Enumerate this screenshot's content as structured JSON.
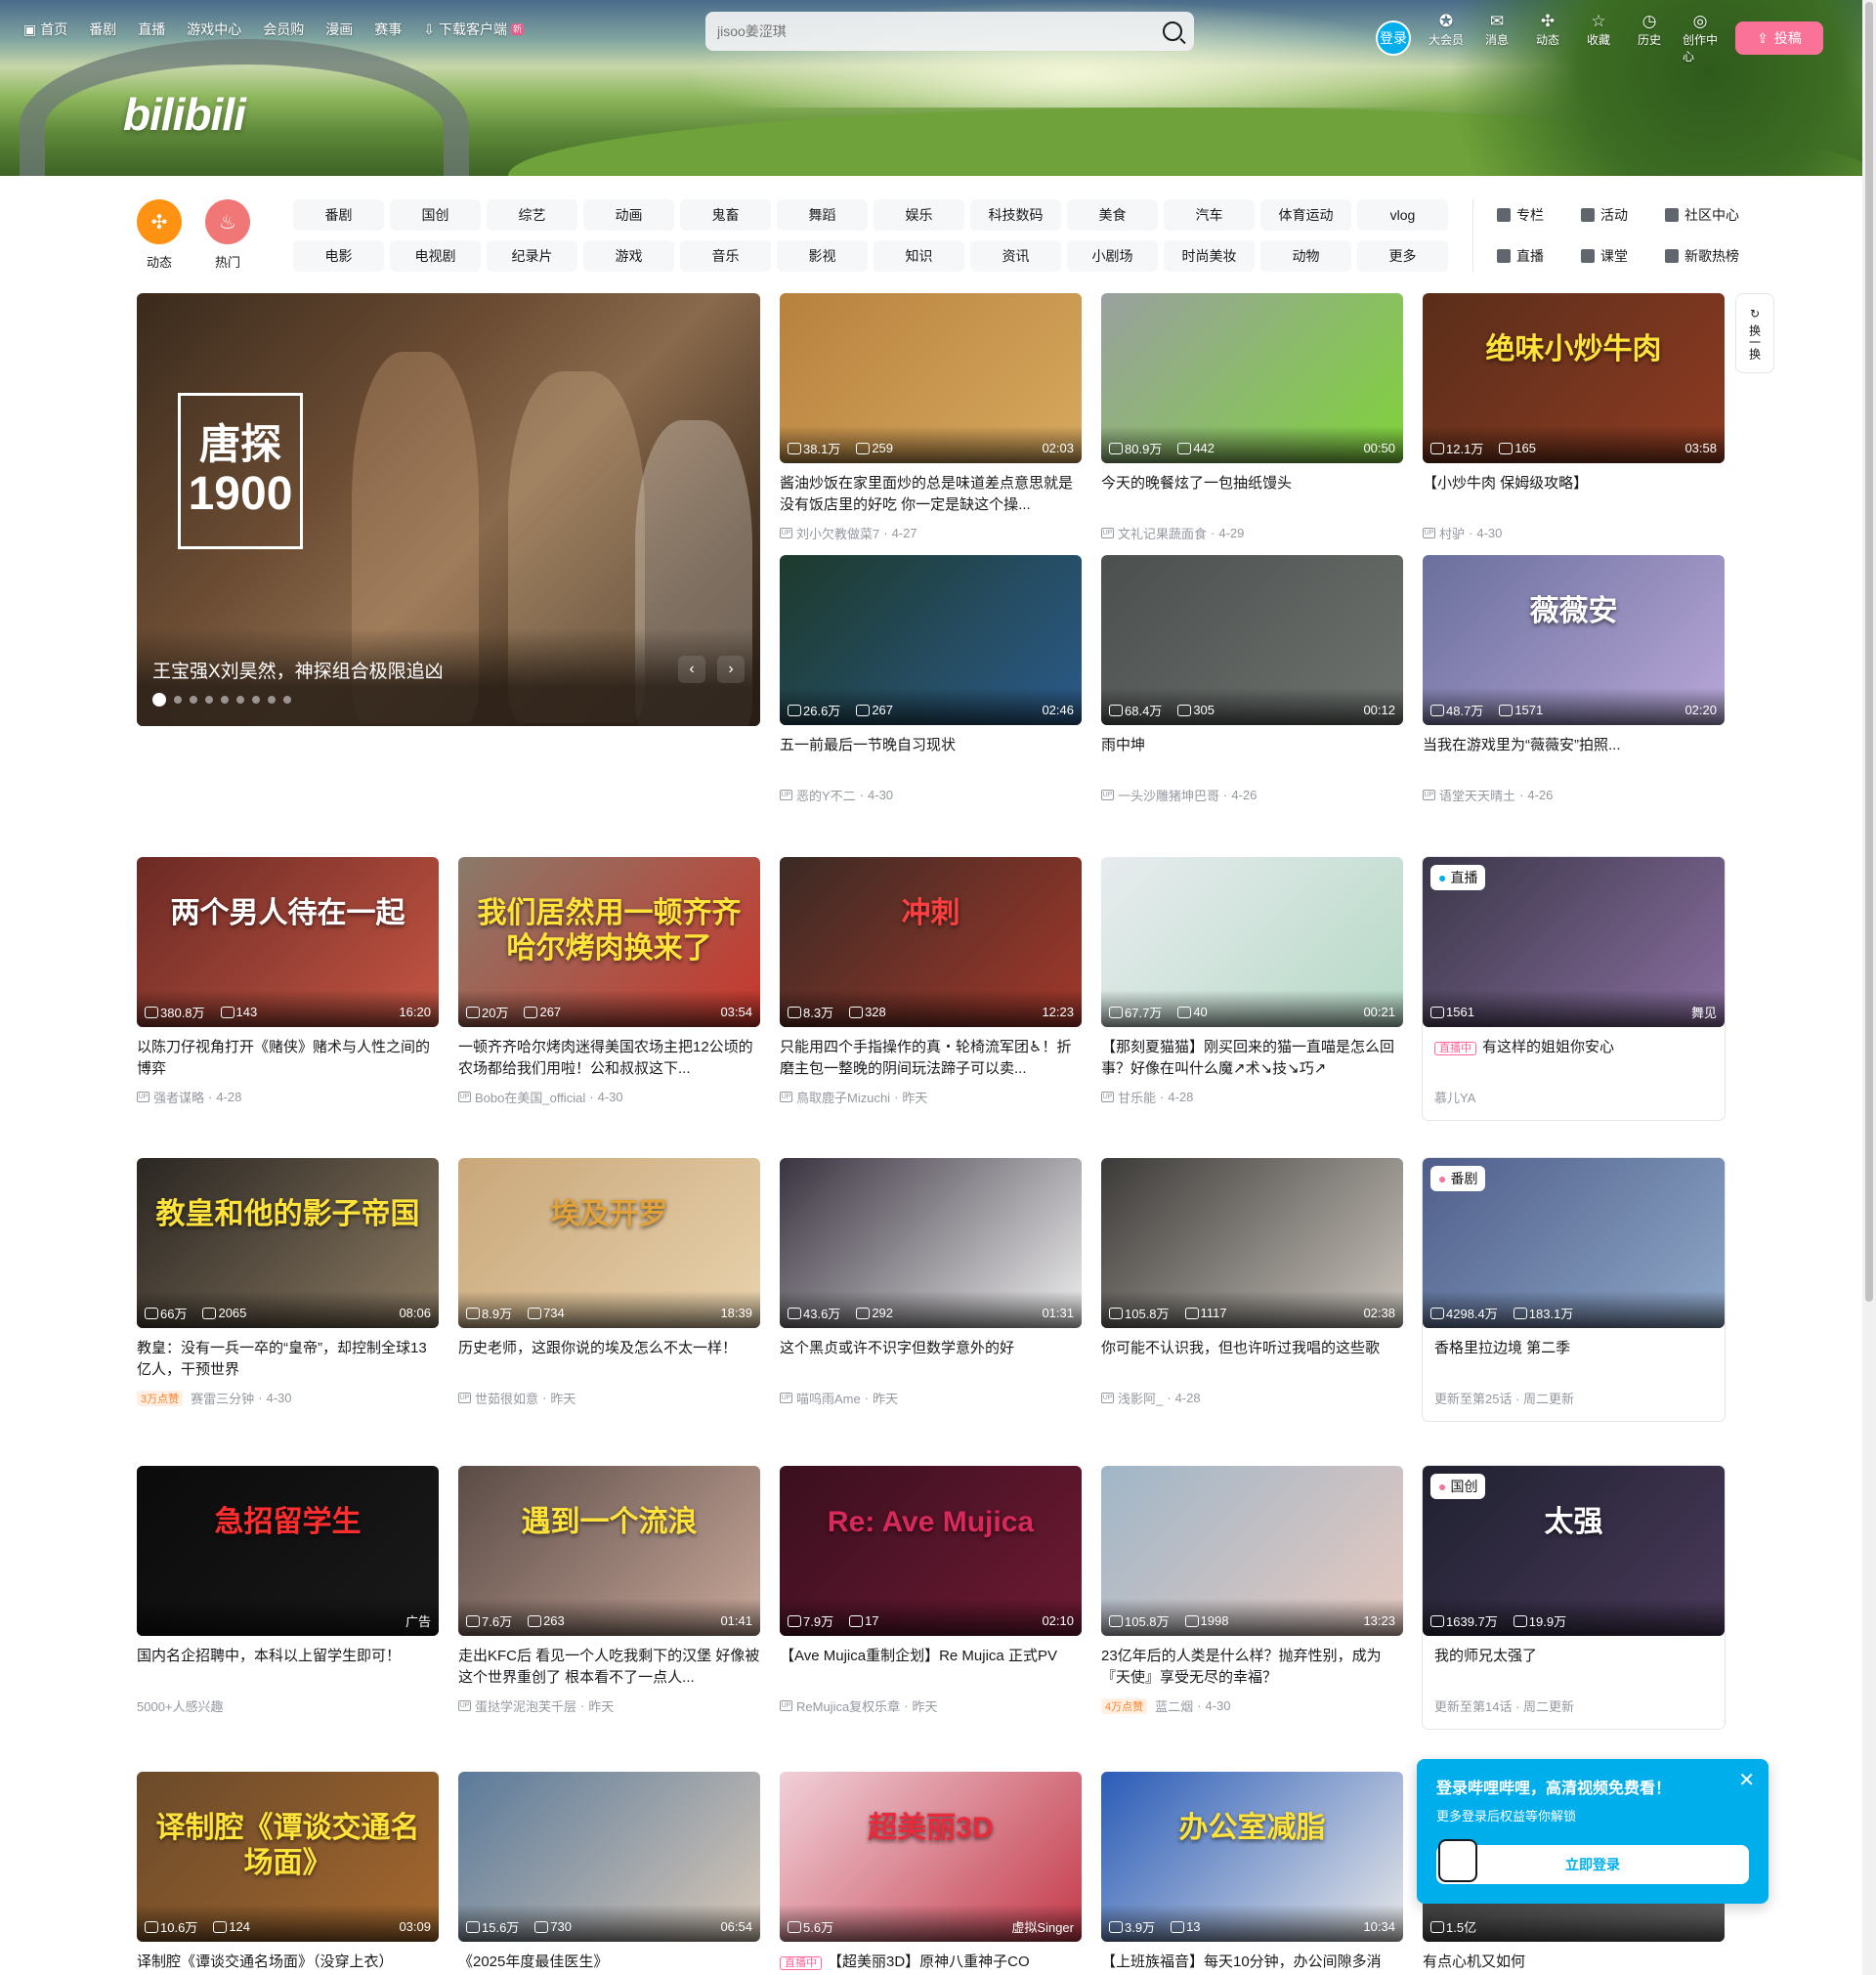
{
  "topnav": [
    {
      "label": "首页",
      "icon": "bilibili-tv-icon"
    },
    {
      "label": "番剧"
    },
    {
      "label": "直播"
    },
    {
      "label": "游戏中心"
    },
    {
      "label": "会员购"
    },
    {
      "label": "漫画"
    },
    {
      "label": "赛事"
    },
    {
      "label": "下载客户端",
      "icon": "download-icon",
      "badge": "新"
    }
  ],
  "search": {
    "placeholder": "jisoo姜涩琪"
  },
  "rightnav": {
    "login": "登录",
    "items": [
      {
        "label": "大会员",
        "icon": "vip-icon"
      },
      {
        "label": "消息",
        "icon": "message-icon"
      },
      {
        "label": "动态",
        "icon": "dynamic-icon"
      },
      {
        "label": "收藏",
        "icon": "star-icon"
      },
      {
        "label": "历史",
        "icon": "history-icon"
      },
      {
        "label": "创作中心",
        "icon": "bulb-icon"
      }
    ],
    "upload": "投稿"
  },
  "logo": "bilibili",
  "channel": {
    "icons": [
      {
        "label": "动态",
        "color": "#ff9212"
      },
      {
        "label": "热门",
        "color": "#f07775"
      }
    ],
    "tags": [
      "番剧",
      "国创",
      "综艺",
      "动画",
      "鬼畜",
      "舞蹈",
      "娱乐",
      "科技数码",
      "美食",
      "汽车",
      "体育运动",
      "vlog",
      "电影",
      "电视剧",
      "纪录片",
      "游戏",
      "音乐",
      "影视",
      "知识",
      "资讯",
      "小剧场",
      "时尚美妆",
      "动物",
      "更多"
    ],
    "right": [
      {
        "label": "专栏",
        "icon": "column-icon"
      },
      {
        "label": "活动",
        "icon": "flag-icon"
      },
      {
        "label": "社区中心",
        "icon": "community-icon"
      },
      {
        "label": "直播",
        "icon": "live-icon"
      },
      {
        "label": "课堂",
        "icon": "classroom-icon"
      },
      {
        "label": "新歌热榜",
        "icon": "music-chart-icon"
      }
    ]
  },
  "carousel": {
    "title": "王宝强X刘昊然，神探组合极限追凶",
    "poster_l1": "唐探",
    "poster_l2": "1900",
    "dots": 9,
    "active": 0,
    "prev": "‹",
    "next": "›"
  },
  "refresh": {
    "label": "换一换"
  },
  "feed": [
    {
      "views": "38.1万",
      "danmaku": "259",
      "duration": "02:03",
      "title": "酱油炒饭在家里面炒的总是味道差点意思就是没有饭店里的好吃 你一定是缺这个操...",
      "author": "刘小欠教做菜7",
      "date": "4-27",
      "bg": "#b7813e",
      "bg2": "#d8a95e"
    },
    {
      "views": "80.9万",
      "danmaku": "442",
      "duration": "00:50",
      "title": "今天的晚餐炫了一包抽纸馒头",
      "author": "文礼记果蔬面食",
      "date": "4-29",
      "bg": "#9aa0a0",
      "bg2": "#7fd33a"
    },
    {
      "views": "12.1万",
      "danmaku": "165",
      "duration": "03:58",
      "title": "【小炒牛肉 保姆级攻略】",
      "author": "村驴",
      "date": "4-30",
      "bg": "#5a2e1a",
      "bg2": "#8e3b22",
      "cap": "绝味小炒牛肉",
      "capc": "#ffe23a"
    },
    {
      "views": "26.6万",
      "danmaku": "267",
      "duration": "02:46",
      "title": "五一前最后一节晚自习现状",
      "author": "恶的Y不二",
      "date": "4-30",
      "bg": "#1d3a2c",
      "bg2": "#2b5a8a"
    },
    {
      "views": "68.4万",
      "danmaku": "305",
      "duration": "00:12",
      "title": "雨中坤",
      "author": "一头沙雕猪坤巴哥",
      "date": "4-26",
      "bg": "#4b4f4e",
      "bg2": "#6e736f"
    },
    {
      "views": "48.7万",
      "danmaku": "1571",
      "duration": "02:20",
      "title": "当我在游戏里为“薇薇安”拍照...",
      "author": "语堂天天晴土",
      "date": "4-26",
      "bg": "#6a6f9c",
      "bg2": "#b8a7d8",
      "cap": "薇薇安",
      "capc": "#ffffff"
    },
    {
      "views": "380.8万",
      "danmaku": "143",
      "duration": "16:20",
      "title": "以陈刀仔视角打开《赌侠》赌术与人性之间的博弈",
      "author": "强者谋略",
      "date": "4-28",
      "bg": "#6b2a24",
      "bg2": "#c55544",
      "cap": "两个男人待在一起",
      "capc": "#ffffff"
    },
    {
      "views": "20万",
      "danmaku": "267",
      "duration": "03:54",
      "title": "一顿齐齐哈尔烤肉迷得美国农场主把12公顷的农场都给我们用啦！公和叔叔这下...",
      "author": "Bobo在美国_official",
      "date": "4-30",
      "bg": "#8a7a6a",
      "bg2": "#c8362c",
      "cap": "我们居然用一顿齐齐哈尔烤肉换来了",
      "capc": "#ffe23a"
    },
    {
      "views": "8.3万",
      "danmaku": "328",
      "duration": "12:23",
      "title": "只能用四个手指操作的真・轮椅流军团♿！折磨主包一整晚的阴间玩法蹄子可以卖...",
      "author": "鳥取鹿子Mizuchi",
      "date": "昨天",
      "bg": "#3a2a24",
      "bg2": "#a3382b",
      "cap": "冲刺",
      "capc": "#ff4040"
    },
    {
      "views": "67.7万",
      "danmaku": "40",
      "duration": "00:21",
      "title": "【那刻夏猫猫】刚买回来的猫一直喵是怎么回事？好像在叫什么魔↗术↘技↘巧↗",
      "author": "甘乐能",
      "date": "4-28",
      "bg": "#e8ecef",
      "bg2": "#b6d9c6"
    },
    {
      "views": "1561",
      "danmaku": "",
      "duration": "舞见",
      "title": "有这样的姐姐你安心",
      "author": "慕儿YA",
      "date": "",
      "bg": "#3a3648",
      "bg2": "#8a6fa0",
      "special": "直播",
      "live": "直播中"
    },
    {
      "views": "66万",
      "danmaku": "2065",
      "duration": "08:06",
      "title": "教皇：没有一兵一卒的“皇帝”，却控制全球13亿人，干预世界",
      "author": "赛雷三分钟",
      "date": "4-30",
      "bg": "#2a2622",
      "bg2": "#8b7a62",
      "cap": "教皇和他的影子帝国",
      "capc": "#ffe23a",
      "hot": "3万点赞"
    },
    {
      "views": "8.9万",
      "danmaku": "734",
      "duration": "18:39",
      "title": "历史老师，这跟你说的埃及怎么不太一样！",
      "author": "世茹很如意",
      "date": "昨天",
      "bg": "#c9a77a",
      "bg2": "#e8d2ad",
      "cap": "埃及开罗",
      "capc": "#e2a23a"
    },
    {
      "views": "43.6万",
      "danmaku": "292",
      "duration": "01:31",
      "title": "这个黑贞或许不识字但数学意外的好",
      "author": "喵呜雨Ame",
      "date": "昨天",
      "bg": "#3a3340",
      "bg2": "#efefef"
    },
    {
      "views": "105.8万",
      "danmaku": "1117",
      "duration": "02:38",
      "title": "你可能不认识我，但也许听过我唱的这些歌",
      "author": "浅影阿_",
      "date": "4-28",
      "bg": "#3c3a38",
      "bg2": "#c9c3bb"
    },
    {
      "views": "4298.4万",
      "danmaku": "183.1万",
      "duration": "",
      "title": "香格里拉边境 第二季",
      "author": "更新至第25话 · 周二更新",
      "date": "",
      "bg": "#4f5e8a",
      "bg2": "#8fa8c8",
      "special": "番剧"
    },
    {
      "views": "",
      "danmaku": "",
      "duration": "广告",
      "title": "国内名企招聘中，本科以上留学生即可！",
      "author": "5000+人感兴趣",
      "date": "",
      "bg": "#0b0b0b",
      "bg2": "#1a1a1a",
      "cap": "急招留学生",
      "capc": "#ff2d2d",
      "ad": true
    },
    {
      "views": "7.6万",
      "danmaku": "263",
      "duration": "01:41",
      "title": "走出KFC后 看见一个人吃我剩下的汉堡 好像被这个世界重创了 根本看不了一点人...",
      "author": "蛋挞学泥泡芙千层",
      "date": "昨天",
      "bg": "#5a4b46",
      "bg2": "#c9a89a",
      "cap": "遇到一个流浪",
      "capc": "#ffe23a"
    },
    {
      "views": "7.9万",
      "danmaku": "17",
      "duration": "02:10",
      "title": "【Ave Mujica重制企划】Re Mujica 正式PV",
      "author": "ReMujica复权乐章",
      "date": "昨天",
      "bg": "#3a0f1e",
      "bg2": "#6e1a34",
      "cap": "Re: Ave Mujica",
      "capc": "#d9285a"
    },
    {
      "views": "105.8万",
      "danmaku": "1998",
      "duration": "13:23",
      "title": "23亿年后的人类是什么样？抛弃性别，成为『天使』享受无尽的幸福？",
      "author": "蓝二烟",
      "date": "4-30",
      "bg": "#9fb6c8",
      "bg2": "#e6c9c0",
      "hot": "4万点赞"
    },
    {
      "views": "1639.7万",
      "danmaku": "19.9万",
      "duration": "",
      "title": "我的师兄太强了",
      "author": "更新至第14话 · 周二更新",
      "date": "",
      "bg": "#1f2030",
      "bg2": "#4a3a5a",
      "special": "国创",
      "cap": "太强",
      "capc": "#ffffff"
    },
    {
      "views": "10.6万",
      "danmaku": "124",
      "duration": "03:09",
      "title": "译制腔《谭谈交通名场面》（没穿上衣）",
      "author": "",
      "date": "",
      "bg": "#6b4a2a",
      "bg2": "#a4672e",
      "cap": "译制腔《谭谈交通名场面》",
      "capc": "#ffe23a"
    },
    {
      "views": "15.6万",
      "danmaku": "730",
      "duration": "06:54",
      "title": "《2025年度最佳医生》",
      "author": "",
      "date": "",
      "bg": "#5a7a9a",
      "bg2": "#d8c8b8"
    },
    {
      "views": "5.6万",
      "danmaku": "",
      "duration": "虚拟Singer",
      "title": "【超美丽3D】原神八重神子CO",
      "author": "",
      "date": "",
      "bg": "#f0d0d8",
      "bg2": "#c43a4a",
      "cap": "超美丽3D",
      "capc": "#e82a3a",
      "live": "直播中"
    },
    {
      "views": "3.9万",
      "danmaku": "13",
      "duration": "10:34",
      "title": "【上班族福音】每天10分钟，办公间隙多消",
      "author": "",
      "date": "",
      "bg": "#2a5cb8",
      "bg2": "#e8e8e8",
      "cap": "办公室减脂",
      "capc": "#ffe23a"
    },
    {
      "views": "1.5亿",
      "danmaku": "",
      "duration": "",
      "title": "有点心机又如何",
      "author": "",
      "date": "",
      "bg": "#3a3a3a",
      "bg2": "#6a6a6a"
    }
  ],
  "popup": {
    "title": "登录哔哩哔哩，高清视频免费看！",
    "sub": "更多登录后权益等你解锁",
    "button": "立即登录",
    "close": "✕"
  }
}
